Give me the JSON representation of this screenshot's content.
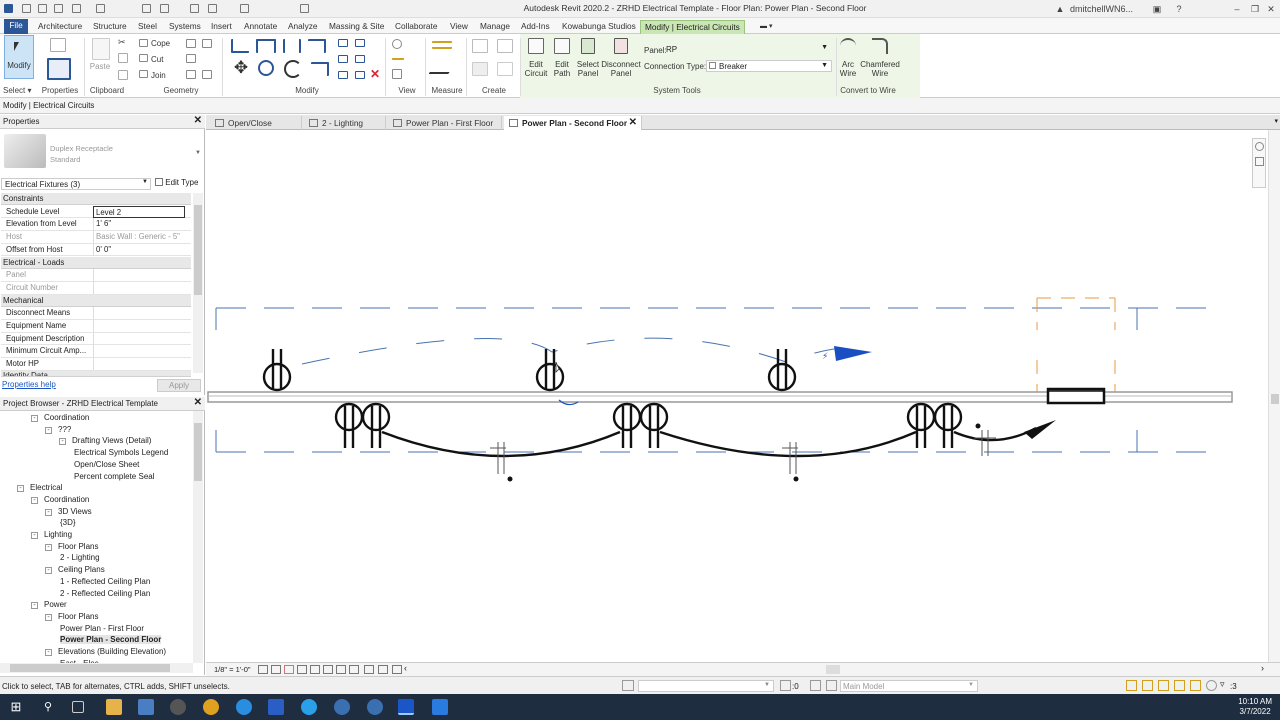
{
  "window": {
    "title": "Autodesk Revit 2020.2 - ZRHD Electrical Template - Floor Plan: Power Plan - Second Floor",
    "user": "dmitchellWN6..."
  },
  "ribbon_tabs": [
    "File",
    "Architecture",
    "Structure",
    "Steel",
    "Systems",
    "Insert",
    "Annotate",
    "Analyze",
    "Massing & Site",
    "Collaborate",
    "View",
    "Manage",
    "Add-Ins",
    "Kowabunga Studios",
    "Modify | Electrical Circuits"
  ],
  "ribbon": {
    "modify_label": "Modify",
    "paste_label": "Paste",
    "cope_label": "Cope",
    "cut_label": "Cut",
    "join_label": "Join",
    "edit_circuit": "Edit\nCircuit",
    "edit_path": "Edit\nPath",
    "select_panel": "Select\nPanel",
    "disconnect_panel": "Disconnect\nPanel",
    "panel_label": "Panel:",
    "panel_value": "RP",
    "connection_type_label": "Connection Type:",
    "connection_type_value": "Breaker",
    "arc_wire": "Arc\nWire",
    "chamfered_wire": "Chamfered\nWire",
    "groups": [
      "Select",
      "Properties",
      "Clipboard",
      "Geometry",
      "Modify",
      "View",
      "Measure",
      "Create",
      "System Tools",
      "Convert to Wire"
    ]
  },
  "options_bar": "Modify | Electrical Circuits",
  "properties": {
    "header": "Properties",
    "family_name": "Duplex Receptacle",
    "family_type": "Standard",
    "selector": "Electrical Fixtures (3)",
    "edit_type": "Edit Type",
    "sections": [
      {
        "name": "Constraints",
        "rows": [
          {
            "k": "Schedule Level",
            "v": "Level 2",
            "editing": true
          },
          {
            "k": "Elevation from Level",
            "v": "1'  6\""
          },
          {
            "k": "Host",
            "v": "Basic Wall : Generic - 5\"",
            "gray": true
          },
          {
            "k": "Offset from Host",
            "v": "0'  0\""
          }
        ]
      },
      {
        "name": "Electrical - Loads",
        "rows": [
          {
            "k": "Panel",
            "v": "",
            "gray": true
          },
          {
            "k": "Circuit Number",
            "v": "",
            "gray": true
          }
        ]
      },
      {
        "name": "Mechanical",
        "rows": [
          {
            "k": "Disconnect Means",
            "v": ""
          },
          {
            "k": "Equipment Name",
            "v": ""
          },
          {
            "k": "Equipment Description",
            "v": ""
          },
          {
            "k": "Minimum Circuit Amp...",
            "v": ""
          },
          {
            "k": "Motor HP",
            "v": ""
          }
        ]
      }
    ],
    "cut_section": "Identity Data",
    "help_link": "Properties help",
    "apply": "Apply"
  },
  "browser": {
    "header": "Project Browser - ZRHD Electrical Template",
    "nodes": [
      {
        "t": "Coordination",
        "lvl": 1,
        "box": "-"
      },
      {
        "t": "???",
        "lvl": 2,
        "box": "-"
      },
      {
        "t": "Drafting Views (Detail)",
        "lvl": 3,
        "box": "-"
      },
      {
        "t": "Electrical Symbols Legend",
        "lvl": 4
      },
      {
        "t": "Open/Close Sheet",
        "lvl": 4
      },
      {
        "t": "Percent complete Seal",
        "lvl": 4
      },
      {
        "t": "Electrical",
        "lvl": 0,
        "box": "-"
      },
      {
        "t": "Coordination",
        "lvl": 1,
        "box": "-"
      },
      {
        "t": "3D Views",
        "lvl": 2,
        "box": "-"
      },
      {
        "t": "{3D}",
        "lvl": 3
      },
      {
        "t": "Lighting",
        "lvl": 1,
        "box": "-"
      },
      {
        "t": "Floor Plans",
        "lvl": 2,
        "box": "-"
      },
      {
        "t": "2 - Lighting",
        "lvl": 3
      },
      {
        "t": "Ceiling Plans",
        "lvl": 2,
        "box": "-"
      },
      {
        "t": "1 - Reflected Ceiling Plan",
        "lvl": 3
      },
      {
        "t": "2 - Reflected Ceiling Plan",
        "lvl": 3
      },
      {
        "t": "Power",
        "lvl": 1,
        "box": "-"
      },
      {
        "t": "Floor Plans",
        "lvl": 2,
        "box": "-"
      },
      {
        "t": "Power Plan - First Floor",
        "lvl": 3
      },
      {
        "t": "Power Plan - Second Floor",
        "lvl": 3,
        "bold": true
      },
      {
        "t": "Elevations (Building Elevation)",
        "lvl": 2,
        "box": "-"
      },
      {
        "t": "East - Elec",
        "lvl": 3
      }
    ]
  },
  "view_tabs": [
    {
      "label": "Open/Close Sheet",
      "active": false
    },
    {
      "label": "2 - Lighting",
      "active": false
    },
    {
      "label": "Power Plan - First Floor",
      "active": false
    },
    {
      "label": "Power Plan - Second Floor",
      "active": true
    }
  ],
  "view_scale": "1/8\" = 1'-0\"",
  "status": {
    "hint": "Click to select, TAB for alternates, CTRL adds, SHIFT unselects.",
    "selection_count": ":0",
    "model": "Main Model",
    "filter_count": ":3"
  },
  "clock": {
    "time": "10:10 AM",
    "date": "3/7/2022"
  },
  "colors": {
    "contextual_tab": "#c9e6b4",
    "file_tab": "#2b5797",
    "taskbar": "#1f2d40",
    "link": "#1a56c8",
    "flag": "#1a4fc4"
  }
}
